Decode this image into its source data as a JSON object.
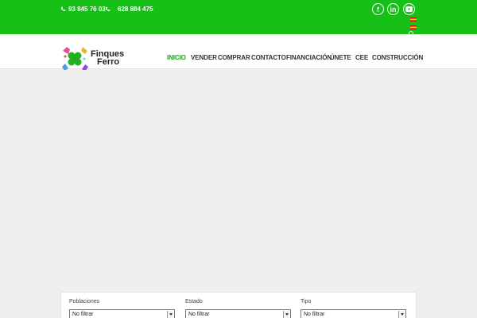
{
  "topbar": {
    "phone_1": "93 845 76 03",
    "phone_2": "628 884 475",
    "social": [
      {
        "icon": "facebook-icon",
        "glyph": "f"
      },
      {
        "icon": "linkedin-icon",
        "glyph": "in"
      },
      {
        "icon": "youtube-icon",
        "glyph": "▶"
      }
    ],
    "color": "#17c017"
  },
  "brand": {
    "line_1": "Finques",
    "line_2": "Ferro"
  },
  "nav": {
    "items": [
      {
        "label": "INICIO",
        "active": true
      },
      {
        "label": "VENDER",
        "active": false
      },
      {
        "label": "COMPRAR",
        "active": false
      },
      {
        "label": "CONTACTO",
        "active": false
      },
      {
        "label": "FINANCIACIÓN",
        "active": false
      },
      {
        "label": "ÚNETE",
        "active": false
      },
      {
        "label": "CEE",
        "active": false
      },
      {
        "label": "CONSTRUCCIÓN",
        "active": false
      }
    ],
    "active_color": "#17a317"
  },
  "filters": {
    "fields": [
      {
        "label": "Poblaciones",
        "value": "No filtrar"
      },
      {
        "label": "Estado",
        "value": "No filtrar"
      },
      {
        "label": "Tipo",
        "value": "No filtrar"
      }
    ]
  }
}
